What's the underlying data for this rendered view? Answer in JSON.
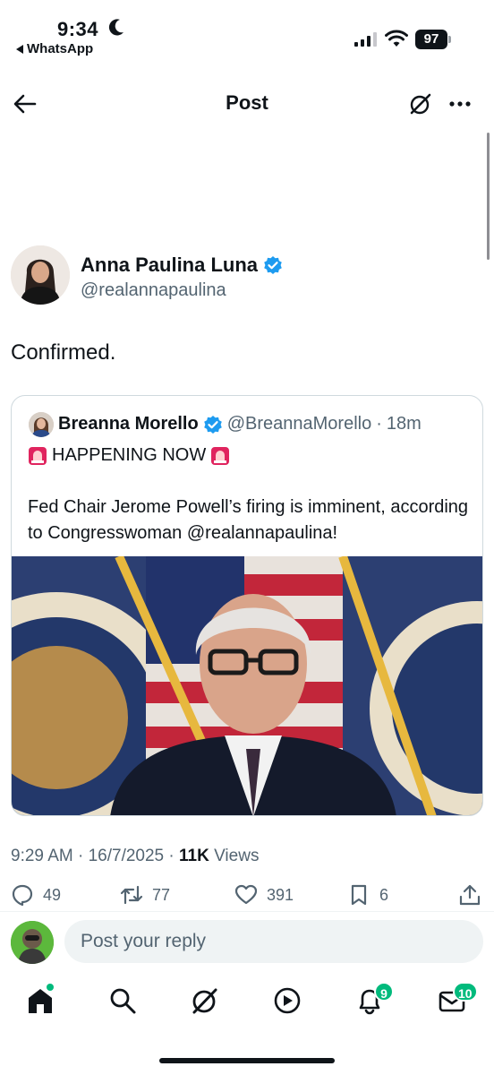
{
  "status_bar": {
    "time": "9:34",
    "back_app": "WhatsApp",
    "battery": "97"
  },
  "header": {
    "title": "Post"
  },
  "post": {
    "author_name": "Anna Paulina Luna",
    "author_handle": "@realannapaulina",
    "text": "Confirmed.",
    "timestamp": "9:29 AM · 16/7/2025 · ",
    "views_count": "11K",
    "views_label": " Views"
  },
  "quote": {
    "name": "Breanna Morello",
    "handle": "@BreannaMorello",
    "separator": "·",
    "time": "18m",
    "headline": "HAPPENING NOW",
    "body": "Fed Chair Jerome Powell’s firing is imminent, according to Congresswoman @realannapaulina!"
  },
  "actions": {
    "replies": "49",
    "reposts": "77",
    "likes": "391",
    "bookmarks": "6"
  },
  "reply": {
    "placeholder": "Post your reply"
  },
  "nav": {
    "notifications_badge": "9",
    "messages_badge": "10"
  },
  "colors": {
    "text": "#0f1419",
    "secondary": "#536471",
    "verified": "#1d9bf0",
    "badge": "#00ba7c",
    "border": "#cfd9de"
  }
}
